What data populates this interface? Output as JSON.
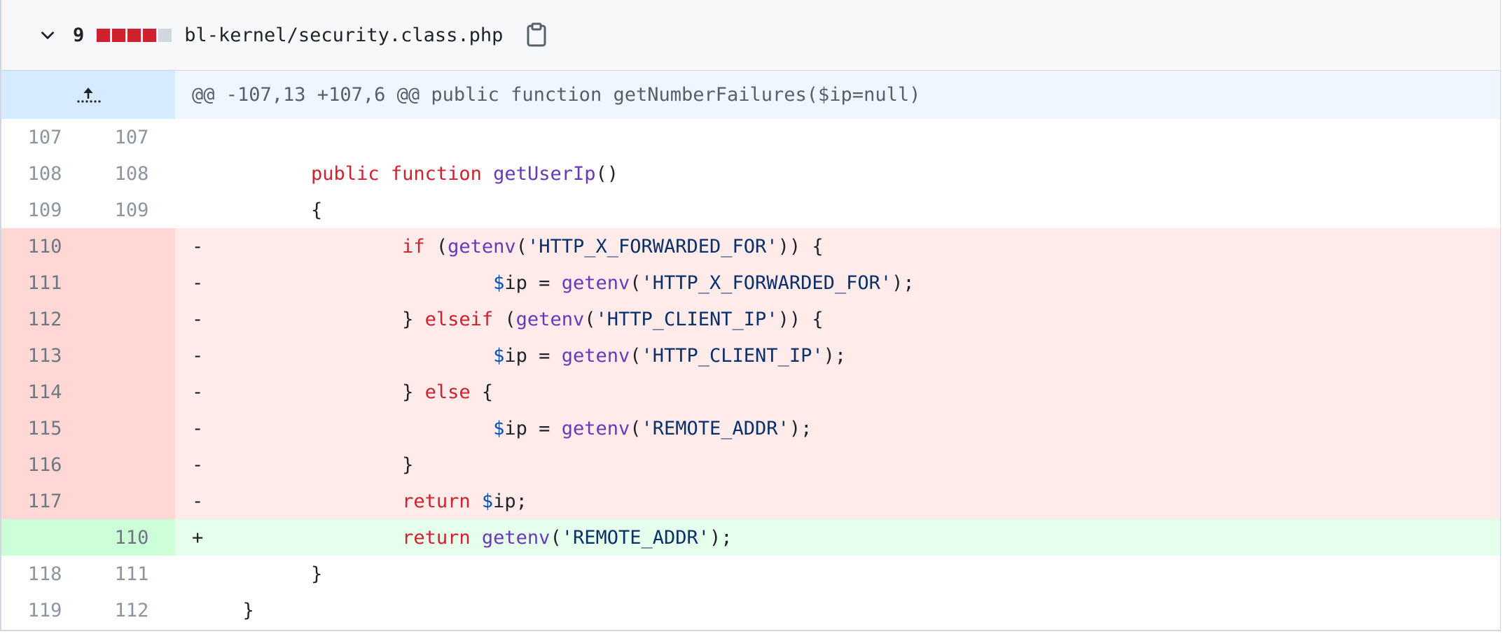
{
  "file": {
    "changes_count": "9",
    "diffstat": [
      "del",
      "del",
      "del",
      "del",
      "neutral"
    ],
    "filename": "bl-kernel/security.class.php",
    "icons": {
      "collapse": "chevron-down-icon",
      "copy": "copy-icon",
      "expand": "expand-up-icon"
    }
  },
  "colors": {
    "deleted": "#cf222e",
    "neutral": "#d0d7de",
    "hunk_bg": "#ddf4ff"
  },
  "hunk": {
    "header": "@@ -107,13 +107,6 @@ public function getNumberFailures($ip=null)"
  },
  "lines": [
    {
      "type": "ctx",
      "old": "107",
      "new": "107",
      "marker": "",
      "tokens": []
    },
    {
      "type": "ctx",
      "old": "108",
      "new": "108",
      "marker": "",
      "tokens": [
        [
          "plain",
          "        "
        ],
        [
          "kw",
          "public"
        ],
        [
          "plain",
          " "
        ],
        [
          "kw",
          "function"
        ],
        [
          "plain",
          " "
        ],
        [
          "fn",
          "getUserIp"
        ],
        [
          "plain",
          "()"
        ]
      ]
    },
    {
      "type": "ctx",
      "old": "109",
      "new": "109",
      "marker": "",
      "tokens": [
        [
          "plain",
          "        {"
        ]
      ]
    },
    {
      "type": "del",
      "old": "110",
      "new": "",
      "marker": "-",
      "tokens": [
        [
          "plain",
          "                "
        ],
        [
          "kw",
          "if"
        ],
        [
          "plain",
          " ("
        ],
        [
          "fn",
          "getenv"
        ],
        [
          "plain",
          "("
        ],
        [
          "str",
          "'HTTP_X_FORWARDED_FOR'"
        ],
        [
          "plain",
          ")) {"
        ]
      ]
    },
    {
      "type": "del",
      "old": "111",
      "new": "",
      "marker": "-",
      "tokens": [
        [
          "plain",
          "                        "
        ],
        [
          "var",
          "$"
        ],
        [
          "plain",
          "ip = "
        ],
        [
          "fn",
          "getenv"
        ],
        [
          "plain",
          "("
        ],
        [
          "str",
          "'HTTP_X_FORWARDED_FOR'"
        ],
        [
          "plain",
          ");"
        ]
      ]
    },
    {
      "type": "del",
      "old": "112",
      "new": "",
      "marker": "-",
      "tokens": [
        [
          "plain",
          "                } "
        ],
        [
          "kw",
          "elseif"
        ],
        [
          "plain",
          " ("
        ],
        [
          "fn",
          "getenv"
        ],
        [
          "plain",
          "("
        ],
        [
          "str",
          "'HTTP_CLIENT_IP'"
        ],
        [
          "plain",
          ")) {"
        ]
      ]
    },
    {
      "type": "del",
      "old": "113",
      "new": "",
      "marker": "-",
      "tokens": [
        [
          "plain",
          "                        "
        ],
        [
          "var",
          "$"
        ],
        [
          "plain",
          "ip = "
        ],
        [
          "fn",
          "getenv"
        ],
        [
          "plain",
          "("
        ],
        [
          "str",
          "'HTTP_CLIENT_IP'"
        ],
        [
          "plain",
          ");"
        ]
      ]
    },
    {
      "type": "del",
      "old": "114",
      "new": "",
      "marker": "-",
      "tokens": [
        [
          "plain",
          "                } "
        ],
        [
          "kw",
          "else"
        ],
        [
          "plain",
          " {"
        ]
      ]
    },
    {
      "type": "del",
      "old": "115",
      "new": "",
      "marker": "-",
      "tokens": [
        [
          "plain",
          "                        "
        ],
        [
          "var",
          "$"
        ],
        [
          "plain",
          "ip = "
        ],
        [
          "fn",
          "getenv"
        ],
        [
          "plain",
          "("
        ],
        [
          "str",
          "'REMOTE_ADDR'"
        ],
        [
          "plain",
          ");"
        ]
      ]
    },
    {
      "type": "del",
      "old": "116",
      "new": "",
      "marker": "-",
      "tokens": [
        [
          "plain",
          "                }"
        ]
      ]
    },
    {
      "type": "del",
      "old": "117",
      "new": "",
      "marker": "-",
      "tokens": [
        [
          "plain",
          "                "
        ],
        [
          "kw",
          "return"
        ],
        [
          "plain",
          " "
        ],
        [
          "var",
          "$"
        ],
        [
          "plain",
          "ip;"
        ]
      ]
    },
    {
      "type": "add",
      "old": "",
      "new": "110",
      "marker": "+",
      "tokens": [
        [
          "plain",
          "                "
        ],
        [
          "kw",
          "return"
        ],
        [
          "plain",
          " "
        ],
        [
          "fn",
          "getenv"
        ],
        [
          "plain",
          "("
        ],
        [
          "str",
          "'REMOTE_ADDR'"
        ],
        [
          "plain",
          ");"
        ]
      ]
    },
    {
      "type": "ctx",
      "old": "118",
      "new": "111",
      "marker": "",
      "tokens": [
        [
          "plain",
          "        }"
        ]
      ]
    },
    {
      "type": "ctx",
      "old": "119",
      "new": "112",
      "marker": "",
      "tokens": [
        [
          "plain",
          "  }"
        ]
      ]
    }
  ]
}
